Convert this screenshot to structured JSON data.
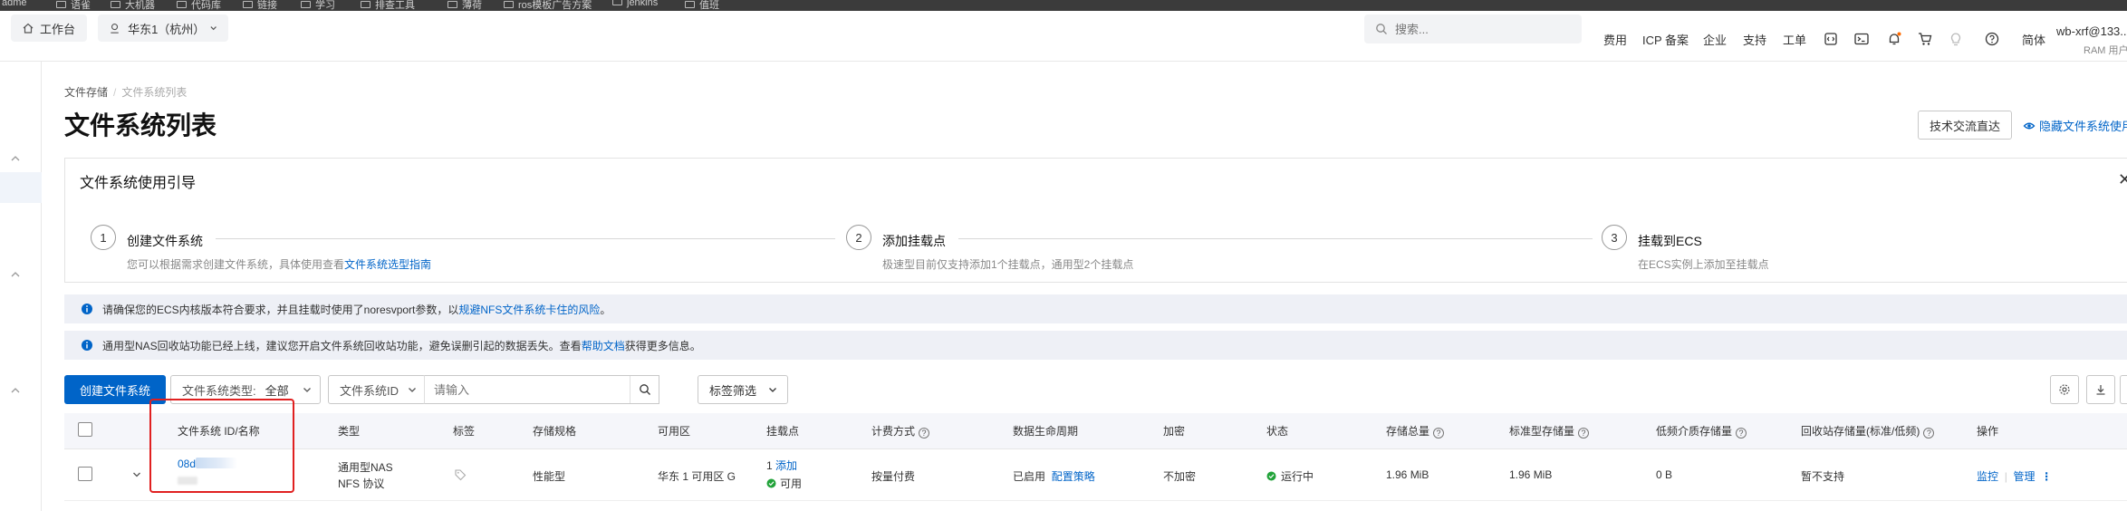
{
  "bookmarks": [
    "adme",
    "语雀",
    "大机器",
    "代码库",
    "链接",
    "学习",
    "排查工具",
    "薄荷",
    "ros模板广告方案",
    "jenkins",
    "值班"
  ],
  "topnav": {
    "workbench": "工作台",
    "region": "华东1（杭州）",
    "search_placeholder": "搜索...",
    "links": [
      "费用",
      "ICP 备案",
      "企业",
      "支持",
      "工单"
    ],
    "lang": "简体",
    "user_name": "wb-xrf@133...",
    "user_role": "RAM 用户",
    "colors": {
      "notify_dot": "#ff6a00"
    }
  },
  "breadcrumb": {
    "root": "文件存储",
    "current": "文件系统列表"
  },
  "page_title": "文件系统列表",
  "tech_button": "技术交流直达",
  "hide_guide": "隐藏文件系统使用",
  "guide": {
    "title": "文件系统使用引导",
    "steps": [
      {
        "num": "1",
        "title": "创建文件系统",
        "desc": "您可以根据需求创建文件系统，具体使用查看",
        "link": "文件系统选型指南"
      },
      {
        "num": "2",
        "title": "添加挂载点",
        "desc": "极速型目前仅支持添加1个挂载点，通用型2个挂载点"
      },
      {
        "num": "3",
        "title": "挂载到ECS",
        "desc": "在ECS实例上添加至挂载点"
      }
    ]
  },
  "notices": [
    {
      "text": "请确保您的ECS内核版本符合要求，并且挂载时使用了noresvport参数，以",
      "link": "规避NFS文件系统卡住的风险",
      "suffix": "。"
    },
    {
      "text": "通用型NAS回收站功能已经上线，建议您开启文件系统回收站功能，避免误删引起的数据丢失。查看",
      "link": "帮助文档",
      "suffix": "获得更多信息。"
    }
  ],
  "toolbar": {
    "create": "创建文件系统",
    "fs_type_label": "文件系统类型:",
    "fs_type_value": "全部",
    "filter_field": "文件系统ID",
    "filter_placeholder": "请输入",
    "tag_filter": "标签筛选"
  },
  "table": {
    "headers": [
      "文件系统 ID/名称",
      "类型",
      "标签",
      "存储规格",
      "可用区",
      "挂载点",
      "计费方式",
      "数据生命周期",
      "加密",
      "状态",
      "存储总量",
      "标准型存储量",
      "低频介质存储量",
      "回收站存储量(标准/低频)",
      "操作"
    ],
    "row": {
      "id": "08d",
      "name": "test",
      "type_line1": "通用型NAS",
      "type_line2": "NFS 协议",
      "spec": "性能型",
      "zone": "华东 1 可用区 G",
      "mount_count": "1",
      "mount_add": "添加",
      "mount_status": "可用",
      "billing": "按量付费",
      "lifecycle": "已启用",
      "lifecycle_link": "配置策略",
      "encrypt": "不加密",
      "status": "运行中",
      "total": "1.96 MiB",
      "standard": "1.96 MiB",
      "ia": "0 B",
      "recycle": "暂不支持",
      "action_monitor": "监控",
      "action_manage": "管理",
      "action_more": "⋮"
    }
  }
}
